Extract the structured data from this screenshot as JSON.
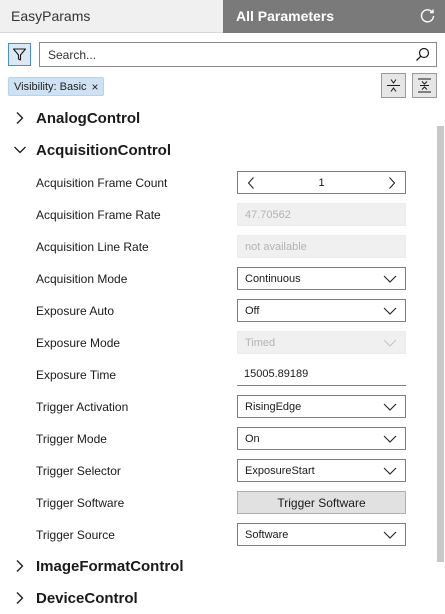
{
  "tabs": {
    "easy_label": "EasyParams",
    "all_label": "All Parameters"
  },
  "search": {
    "placeholder": "Search..."
  },
  "filter": {
    "chip_label": "Visibility: Basic",
    "chip_close": "×"
  },
  "groups": {
    "analog": "AnalogControl",
    "acquisition": "AcquisitionControl",
    "imageformat": "ImageFormatControl",
    "device": "DeviceControl"
  },
  "params": [
    {
      "label": "Acquisition Frame Count",
      "value": "1"
    },
    {
      "label": "Acquisition Frame Rate",
      "value": "47.70562"
    },
    {
      "label": "Acquisition Line Rate",
      "value": "not available"
    },
    {
      "label": "Acquisition Mode",
      "value": "Continuous"
    },
    {
      "label": "Exposure Auto",
      "value": "Off"
    },
    {
      "label": "Exposure Mode",
      "value": "Timed"
    },
    {
      "label": "Exposure Time",
      "value": "15005.89189"
    },
    {
      "label": "Trigger Activation",
      "value": "RisingEdge"
    },
    {
      "label": "Trigger Mode",
      "value": "On"
    },
    {
      "label": "Trigger Selector",
      "value": "ExposureStart"
    },
    {
      "label": "Trigger Software",
      "value": "Trigger Software"
    },
    {
      "label": "Trigger Source",
      "value": "Software"
    }
  ],
  "colors": {
    "active_tab": "#7a7a7a",
    "chip_bg": "#cfe2f3",
    "filter_accent": "#4a8fc8"
  }
}
